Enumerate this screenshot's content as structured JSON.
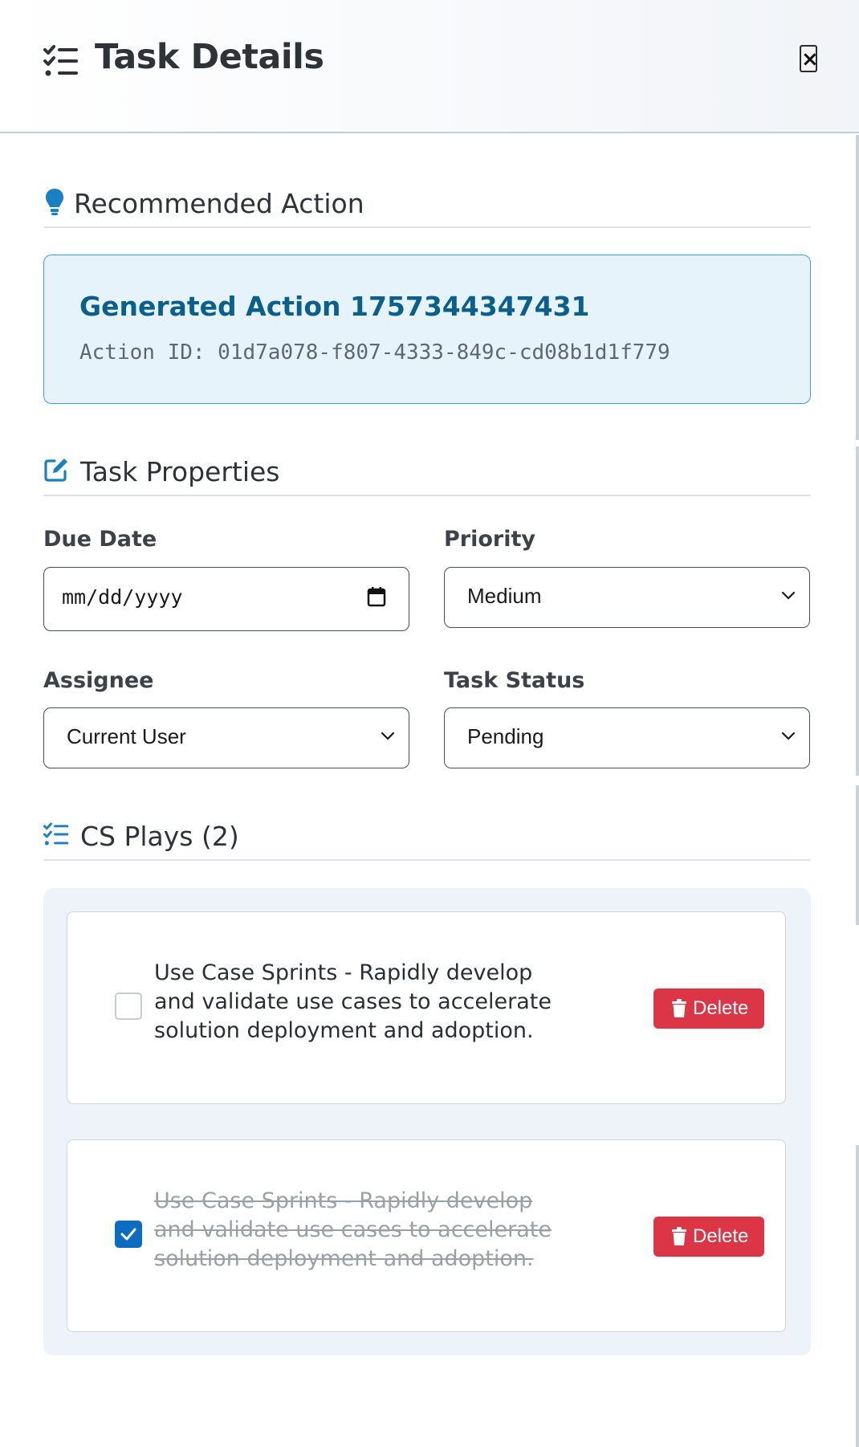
{
  "header": {
    "title": "Task Details",
    "close_label": "×"
  },
  "recommended": {
    "section_title": "Recommended Action",
    "action_title": "Generated Action 1757344347431",
    "action_id": "Action ID: 01d7a078-f807-4333-849c-cd08b1d1f779"
  },
  "properties": {
    "section_title": "Task Properties",
    "due_date": {
      "label": "Due Date",
      "placeholder": "mm/dd/yyyy"
    },
    "priority": {
      "label": "Priority",
      "value": "Medium"
    },
    "assignee": {
      "label": "Assignee",
      "value": "Current User"
    },
    "status": {
      "label": "Task Status",
      "value": "Pending"
    }
  },
  "plays": {
    "section_title": "CS Plays (2)",
    "items": [
      {
        "text": "Use Case Sprints - Rapidly develop and validate use cases to accelerate solution deployment and adoption.",
        "checked": false,
        "delete_label": "Delete"
      },
      {
        "text": "Use Case Sprints - Rapidly develop and validate use cases to accelerate solution deployment and adoption.",
        "checked": true,
        "delete_label": "Delete"
      }
    ]
  },
  "colors": {
    "accent": "#0d6cc2",
    "card_title": "#0b5f8c",
    "card_bg": "#e7f3fa",
    "card_border": "#3ca3d8",
    "danger": "#dc3545",
    "plays_bg": "#eef2f9"
  },
  "icons": {
    "title": "list-check-icon",
    "recommended": "lightbulb-icon",
    "properties": "edit-icon",
    "plays": "list-check-icon",
    "delete": "trash-icon",
    "date": "calendar-icon",
    "select": "chevron-down-icon"
  }
}
